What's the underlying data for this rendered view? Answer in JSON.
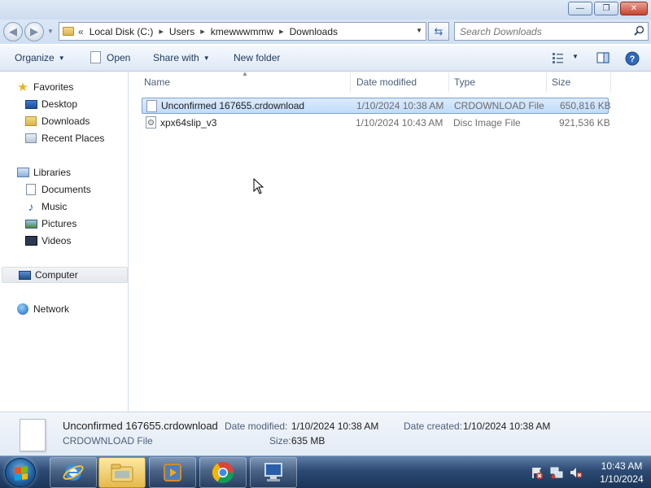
{
  "window": {
    "controls": {
      "minimize": "—",
      "maximize": "❐",
      "close": "✕"
    }
  },
  "address": {
    "overflow": "«",
    "crumbs": [
      "Local Disk (C:)",
      "Users",
      "kmewwwmmw",
      "Downloads"
    ],
    "search_placeholder": "Search Downloads"
  },
  "toolbar": {
    "organize": "Organize",
    "open": "Open",
    "share_with": "Share with",
    "new_folder": "New folder"
  },
  "nav": {
    "favorites": "Favorites",
    "desktop": "Desktop",
    "downloads": "Downloads",
    "recent_places": "Recent Places",
    "libraries": "Libraries",
    "documents": "Documents",
    "music": "Music",
    "pictures": "Pictures",
    "videos": "Videos",
    "computer": "Computer",
    "network": "Network"
  },
  "columns": {
    "name": "Name",
    "date_modified": "Date modified",
    "type": "Type",
    "size": "Size"
  },
  "files": [
    {
      "name": "Unconfirmed 167655.crdownload",
      "date": "1/10/2024 10:38 AM",
      "type": "CRDOWNLOAD File",
      "size": "650,816 KB",
      "icon": "blank-file-icon",
      "selected": true
    },
    {
      "name": "xpx64slip_v3",
      "date": "1/10/2024 10:43 AM",
      "type": "Disc Image File",
      "size": "921,536 KB",
      "icon": "disc-image-icon",
      "selected": false
    }
  ],
  "details": {
    "name": "Unconfirmed 167655.crdownload",
    "type": "CRDOWNLOAD File",
    "date_modified_label": "Date modified:",
    "date_modified": "1/10/2024 10:38 AM",
    "date_created_label": "Date created:",
    "date_created": "1/10/2024 10:38 AM",
    "size_label": "Size:",
    "size": "635 MB"
  },
  "taskbar": {
    "apps": [
      "internet-explorer-icon",
      "file-explorer-icon",
      "media-player-icon",
      "chrome-icon",
      "remote-desktop-icon"
    ],
    "clock_time": "10:43 AM",
    "clock_date": "1/10/2024"
  },
  "colors": {
    "selection": "#c1dcfb",
    "selection_border": "#7da2ce",
    "taskbar": "#1c3558",
    "link_text": "#1e395b"
  }
}
